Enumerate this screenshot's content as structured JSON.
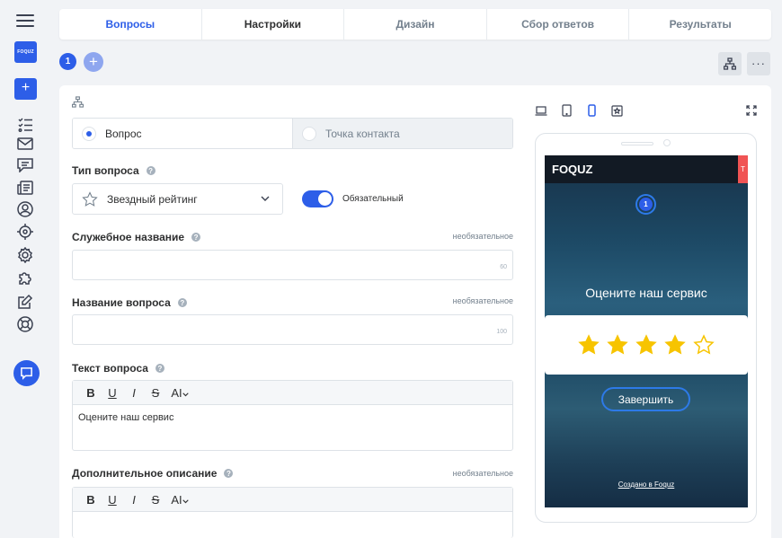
{
  "app": {
    "logo_text": "FOQUZ",
    "add_label": "+"
  },
  "tabs": [
    {
      "label": "Вопросы"
    },
    {
      "label": "Настройки"
    },
    {
      "label": "Дизайн"
    },
    {
      "label": "Сбор ответов"
    },
    {
      "label": "Результаты"
    }
  ],
  "pages": {
    "current": "1",
    "add_label": "+"
  },
  "question_kind": {
    "options": [
      "Вопрос",
      "Точка контакта"
    ],
    "selected": "Вопрос"
  },
  "question_type": {
    "label": "Тип вопроса",
    "value": "Звездный рейтинг",
    "icon": "star-outline-icon"
  },
  "required_toggle": {
    "label": "Обязательный",
    "on": true
  },
  "service_name": {
    "label": "Служебное название",
    "optional": "необязательное",
    "value": "",
    "limit": "60"
  },
  "question_name": {
    "label": "Название вопроса",
    "optional": "необязательное",
    "value": "",
    "limit": "100"
  },
  "question_text": {
    "label": "Текст вопроса",
    "value": "Оцените наш сервис"
  },
  "description": {
    "label": "Дополнительное описание",
    "optional": "необязательное",
    "value": ""
  },
  "toolbar": {
    "bold": "B",
    "underline": "U",
    "italic": "I",
    "strike": "S",
    "ai": "AI"
  },
  "preview": {
    "brand": "FOQUZ",
    "corner_tab": "T",
    "page_number": "1",
    "question": "Оцените наш сервис",
    "rating_value": 4,
    "rating_max": 5,
    "finish_button": "Завершить",
    "made_with": "Создано в Foquz"
  },
  "colors": {
    "accent": "#2d5ee8",
    "star": "#f7c400",
    "corner": "#f05454"
  }
}
